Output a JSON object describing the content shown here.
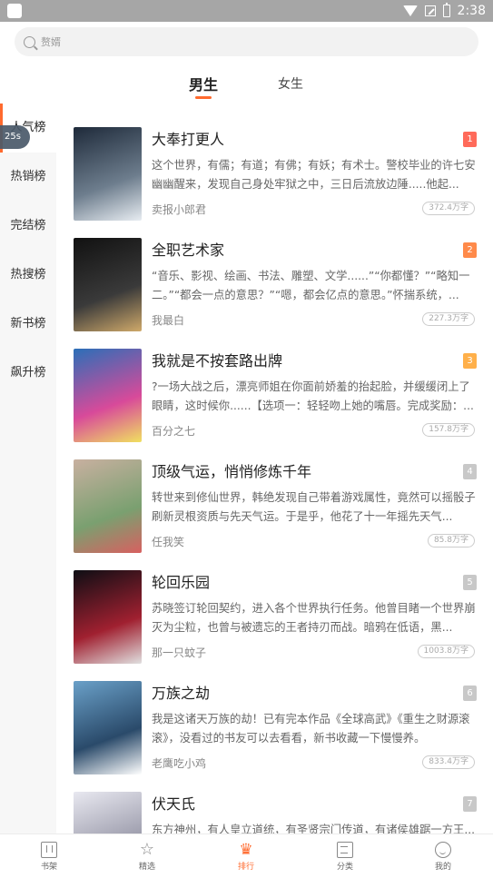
{
  "status_bar": {
    "time": "2:38"
  },
  "search": {
    "placeholder": "赘婿"
  },
  "gender_tabs": [
    {
      "label": "男生",
      "active": true
    },
    {
      "label": "女生",
      "active": false
    }
  ],
  "sidebar": {
    "items": [
      {
        "label": "人气榜",
        "active": true
      },
      {
        "label": "热销榜",
        "active": false
      },
      {
        "label": "完结榜",
        "active": false
      },
      {
        "label": "热搜榜",
        "active": false
      },
      {
        "label": "新书榜",
        "active": false
      },
      {
        "label": "飙升榜",
        "active": false
      }
    ],
    "overlay_badge": "25s"
  },
  "books": [
    {
      "rank": "1",
      "title": "大奉打更人",
      "desc": "这个世界，有儒；有道；有佛；有妖；有术士。警校毕业的许七安幽幽醒来，发现自己身处牢狱之中，三日后流放边陲.....他起...",
      "author": "卖报小郎君",
      "words": "372.4万字",
      "rank_color": "#ff6a5a",
      "cover_colors": [
        "#1e2a3a",
        "#6d7d8d",
        "#e8edf2"
      ]
    },
    {
      "rank": "2",
      "title": "全职艺术家",
      "desc": "“音乐、影视、绘画、书法、雕塑、文学......”“你都懂？”“略知一二。”“都会一点的意思？”“嗯，都会亿点的意思。”怀揣系统，...",
      "author": "我最白",
      "words": "227.3万字",
      "rank_color": "#ff8a4a",
      "cover_colors": [
        "#111111",
        "#3a3a3a",
        "#cfa96a"
      ]
    },
    {
      "rank": "3",
      "title": "我就是不按套路出牌",
      "desc": "?一场大战之后，漂亮师姐在你面前娇羞的抬起脸，并缓缓闭上了眼睛，这时候你......【选项一：轻轻吻上她的嘴唇。完成奖励：...",
      "author": "百分之七",
      "words": "157.8万字",
      "rank_color": "#ffb04a",
      "cover_colors": [
        "#2b6fb8",
        "#d84a9a",
        "#f0e060"
      ]
    },
    {
      "rank": "4",
      "title": "顶级气运，悄悄修炼千年",
      "desc": "转世来到修仙世界，韩绝发现自己带着游戏属性，竟然可以摇骰子刷新灵根资质与先天气运。于是乎，他花了十一年摇先天气...",
      "author": "任我笑",
      "words": "85.8万字",
      "rank_color": "#c8c8c8",
      "cover_colors": [
        "#c8b0a0",
        "#7aa070",
        "#d86060"
      ]
    },
    {
      "rank": "5",
      "title": "轮回乐园",
      "desc": "苏晓签订轮回契约，进入各个世界执行任务。他曾目睹一个世界崩灭为尘粒，也曾与被遗忘的王者持刃而战。暗鸦在低语，黑...",
      "author": "那一只蚊子",
      "words": "1003.8万字",
      "rank_color": "#c8c8c8",
      "cover_colors": [
        "#0e0e14",
        "#a02030",
        "#e0e0e0"
      ]
    },
    {
      "rank": "6",
      "title": "万族之劫",
      "desc": "我是这诸天万族的劫！已有完本作品《全球高武》《重生之财源滚滚》，没看过的书友可以去看看，新书收藏一下慢慢养。",
      "author": "老鹰吃小鸡",
      "words": "833.4万字",
      "rank_color": "#c8c8c8",
      "cover_colors": [
        "#6aa0c8",
        "#2a4a6a",
        "#ffffff"
      ]
    },
    {
      "rank": "7",
      "title": "伏天氏",
      "desc": "东方神州，有人皇立道统，有圣贤宗门传道，有诸侯雄踞一方王...",
      "author": "",
      "words": "",
      "rank_color": "#c8c8c8",
      "cover_colors": [
        "#e8e8f0",
        "#9a9aaa",
        "#4a3a3a"
      ]
    }
  ],
  "bottom_nav": [
    {
      "label": "书架",
      "icon": "bookshelf-icon",
      "active": false
    },
    {
      "label": "精选",
      "icon": "star-icon",
      "active": false
    },
    {
      "label": "排行",
      "icon": "crown-icon",
      "active": true
    },
    {
      "label": "分类",
      "icon": "category-icon",
      "active": false
    },
    {
      "label": "我的",
      "icon": "profile-icon",
      "active": false
    }
  ],
  "colors": {
    "accent": "#ff6a2e",
    "sidebar_bg": "#f7f7f7",
    "status_bar": "#a6a6a6"
  }
}
